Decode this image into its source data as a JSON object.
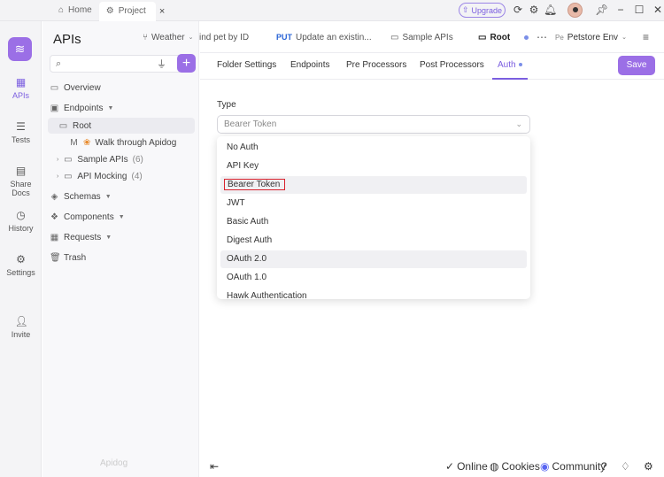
{
  "titlebar": {
    "home_label": "Home",
    "project_label": "Project",
    "upgrade_label": "Upgrade"
  },
  "rail": {
    "items": [
      {
        "label": "APIs"
      },
      {
        "label": "Tests"
      },
      {
        "label": "Share Docs"
      },
      {
        "label": "History"
      },
      {
        "label": "Settings"
      },
      {
        "label": "Invite"
      }
    ]
  },
  "tree": {
    "title": "APIs",
    "items": [
      {
        "label": "Overview",
        "count": ""
      },
      {
        "label": "Endpoints",
        "count": ""
      },
      {
        "label": "Root",
        "count": ""
      },
      {
        "label": "Walk through Apidog",
        "count": ""
      },
      {
        "label": "Sample APIs",
        "count": "(6)"
      },
      {
        "label": "API Mocking",
        "count": "(4)"
      },
      {
        "label": "Schemas",
        "count": ""
      },
      {
        "label": "Components",
        "count": ""
      },
      {
        "label": "Requests",
        "count": ""
      },
      {
        "label": "Trash",
        "count": ""
      }
    ]
  },
  "apitabs": {
    "weather": "Weather",
    "find_pet": "ind pet by ID",
    "put_method": "PUT",
    "update": "Update an existin...",
    "sample": "Sample APIs",
    "root": "Root",
    "env": "Petstore Env",
    "env_prefix": "Pe"
  },
  "subtabs": {
    "folder_settings": "Folder Settings",
    "endpoints": "Endpoints",
    "pre": "Pre Processors",
    "post": "Post Processors",
    "auth": "Auth",
    "save": "Save"
  },
  "auth": {
    "type_label": "Type",
    "selected": "Bearer Token",
    "options": [
      "No Auth",
      "API Key",
      "Bearer Token",
      "JWT",
      "Basic Auth",
      "Digest Auth",
      "OAuth 2.0",
      "OAuth 1.0",
      "Hawk Authentication"
    ]
  },
  "footer": {
    "online": "Online",
    "cookies": "Cookies",
    "community": "Community",
    "watermark": "Apidog"
  },
  "colors": {
    "accent": "#9b6fe6",
    "highlight_border": "#d9232e"
  }
}
